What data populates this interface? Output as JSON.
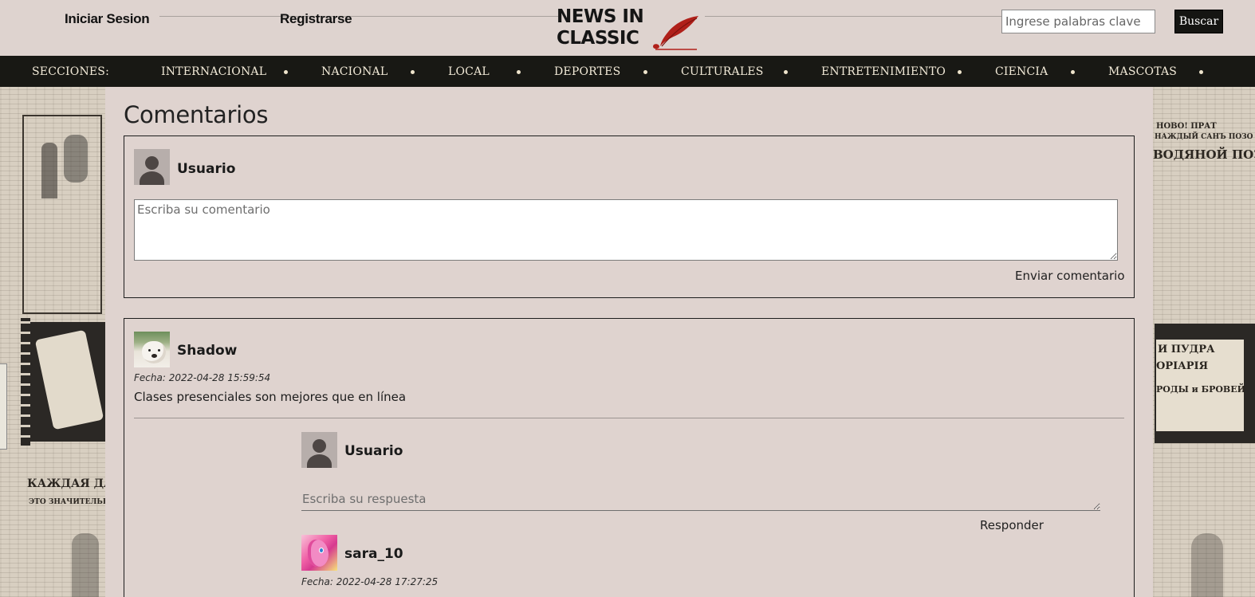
{
  "header": {
    "login_label": "Iniciar Sesion",
    "register_label": "Registrarse",
    "logo_line1": "NEWS IN",
    "logo_line2": "CLASSIC",
    "search_placeholder": "Ingrese palabras clave",
    "search_button_label": "Buscar"
  },
  "nav": {
    "sections_label": "SECCIONES:",
    "items": [
      {
        "label": "INTERNACIONAL"
      },
      {
        "label": "NACIONAL"
      },
      {
        "label": "LOCAL"
      },
      {
        "label": "DEPORTES"
      },
      {
        "label": "CULTURALES"
      },
      {
        "label": "ENTRETENIMIENTO"
      },
      {
        "label": "CIENCIA"
      },
      {
        "label": "MASCOTAS"
      }
    ]
  },
  "comments": {
    "title": "Comentarios",
    "new_comment": {
      "username": "Usuario",
      "placeholder": "Escriba su comentario",
      "submit_label": "Enviar comentario"
    },
    "thread": {
      "username": "Shadow",
      "date": "Fecha: 2022-04-28 15:59:54",
      "text": "Clases presenciales son mejores que en línea",
      "reply_form": {
        "username": "Usuario",
        "placeholder": "Escriba su respuesta",
        "submit_label": "Responder"
      },
      "replies": [
        {
          "username": "sara_10",
          "date": "Fecha: 2022-04-28 17:27:25"
        }
      ]
    }
  },
  "colors": {
    "page_bg": "#dfd3cf",
    "nav_bg": "#181814",
    "nav_text": "#f2ead8",
    "button_bg": "#151512",
    "logo_quill": "#b0201a"
  },
  "icons": {
    "default_avatar": "user-silhouette-icon",
    "logo_quill": "quill-icon"
  }
}
